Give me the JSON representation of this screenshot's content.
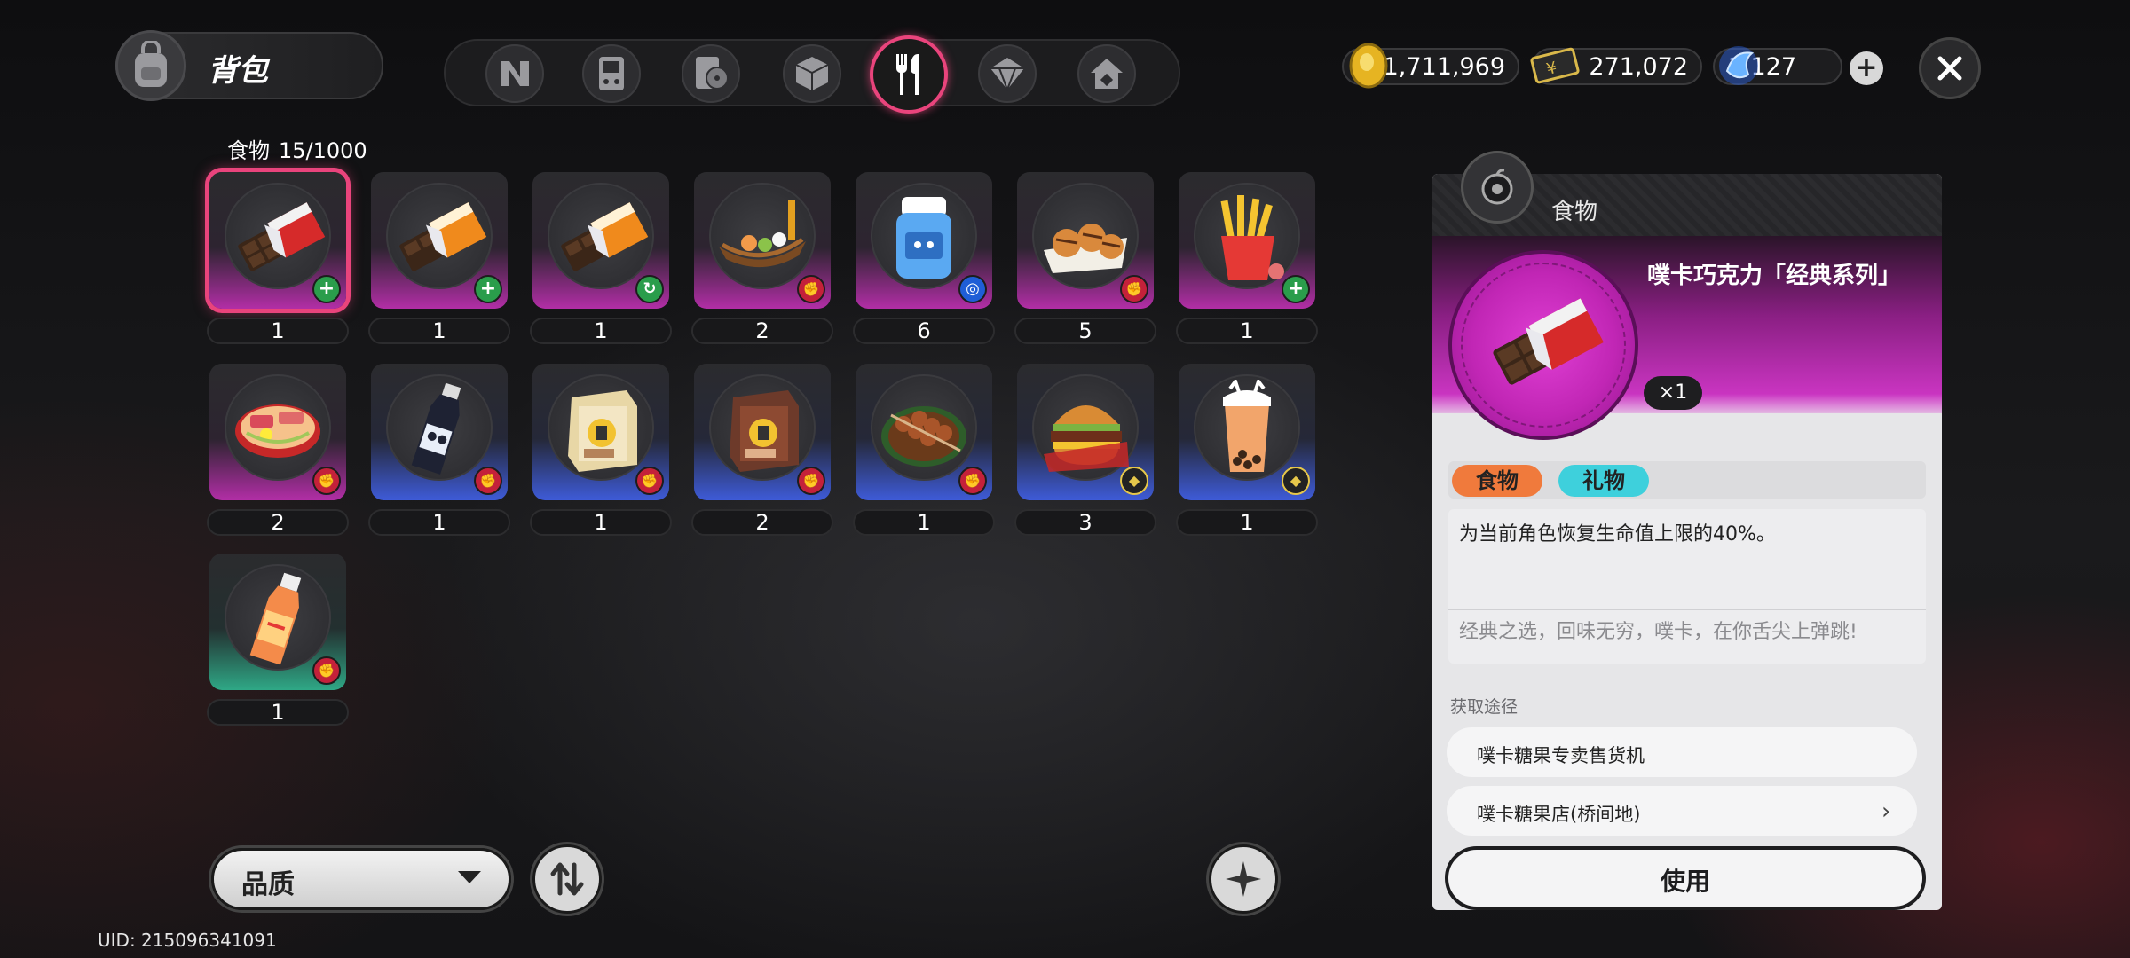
{
  "header": {
    "title": "背包",
    "category_tabs": [
      "n-logo-icon",
      "gameboy-icon",
      "cd-player-icon",
      "cube-icon",
      "food-utensils-icon",
      "gem-icon",
      "house-icon"
    ],
    "active_tab": 4
  },
  "currencies": [
    {
      "name": "gold-coin-icon",
      "value": "1,711,969"
    },
    {
      "name": "ticket-icon",
      "value": "271,072"
    },
    {
      "name": "crystal-icon",
      "value": "1,127"
    }
  ],
  "inventory": {
    "category": "食物",
    "count": "15/1000",
    "items": [
      {
        "icon": "chocolate-bar-icon",
        "qty": "1",
        "rarity": "purple",
        "badge": "plus"
      },
      {
        "icon": "chocolate-bar-icon",
        "qty": "1",
        "rarity": "purple",
        "badge": "plus"
      },
      {
        "icon": "chocolate-bar-icon",
        "qty": "1",
        "rarity": "purple",
        "badge": "recycle"
      },
      {
        "icon": "sushi-boat-icon",
        "qty": "2",
        "rarity": "purple",
        "badge": "fist"
      },
      {
        "icon": "drink-bottle-icon",
        "qty": "6",
        "rarity": "purple",
        "badge": "ring"
      },
      {
        "icon": "takoyaki-icon",
        "qty": "5",
        "rarity": "purple",
        "badge": "fist"
      },
      {
        "icon": "french-fries-icon",
        "qty": "1",
        "rarity": "purple",
        "badge": "plus"
      },
      {
        "icon": "ramen-bowl-icon",
        "qty": "2",
        "rarity": "purple",
        "badge": "fist"
      },
      {
        "icon": "soda-bottle-icon",
        "qty": "1",
        "rarity": "blue",
        "badge": "fist"
      },
      {
        "icon": "snack-box-icon",
        "qty": "1",
        "rarity": "blue",
        "badge": "fist"
      },
      {
        "icon": "snack-box-icon",
        "qty": "2",
        "rarity": "blue",
        "badge": "fist"
      },
      {
        "icon": "skewers-icon",
        "qty": "1",
        "rarity": "blue",
        "badge": "fist"
      },
      {
        "icon": "burger-icon",
        "qty": "3",
        "rarity": "blue",
        "badge": "shield"
      },
      {
        "icon": "bubble-tea-icon",
        "qty": "1",
        "rarity": "blue",
        "badge": "shield"
      },
      {
        "icon": "juice-bottle-icon",
        "qty": "1",
        "rarity": "green",
        "badge": "fist"
      }
    ]
  },
  "controls": {
    "sort_label": "品质",
    "uid": "UID: 215096341091"
  },
  "detail": {
    "category": "食物",
    "name": "噗卡巧克力「经典系列」",
    "count": "×1",
    "tags": [
      "食物",
      "礼物"
    ],
    "description": "为当前角色恢复生命值上限的40%。",
    "flavor": "经典之选，回味无穷，噗卡，在你舌尖上弹跳!",
    "source_label": "获取途径",
    "sources": [
      "噗卡糖果专卖售货机",
      "噗卡糖果店(桥间地)"
    ],
    "use_label": "使用"
  },
  "colors": {
    "accent": "#e9447c",
    "rarity_purple": "#b22ea6",
    "rarity_blue": "#3e5bd8",
    "rarity_green": "#2fa886",
    "tag_food": "#f07a3c",
    "tag_gift": "#3ed0dc"
  }
}
